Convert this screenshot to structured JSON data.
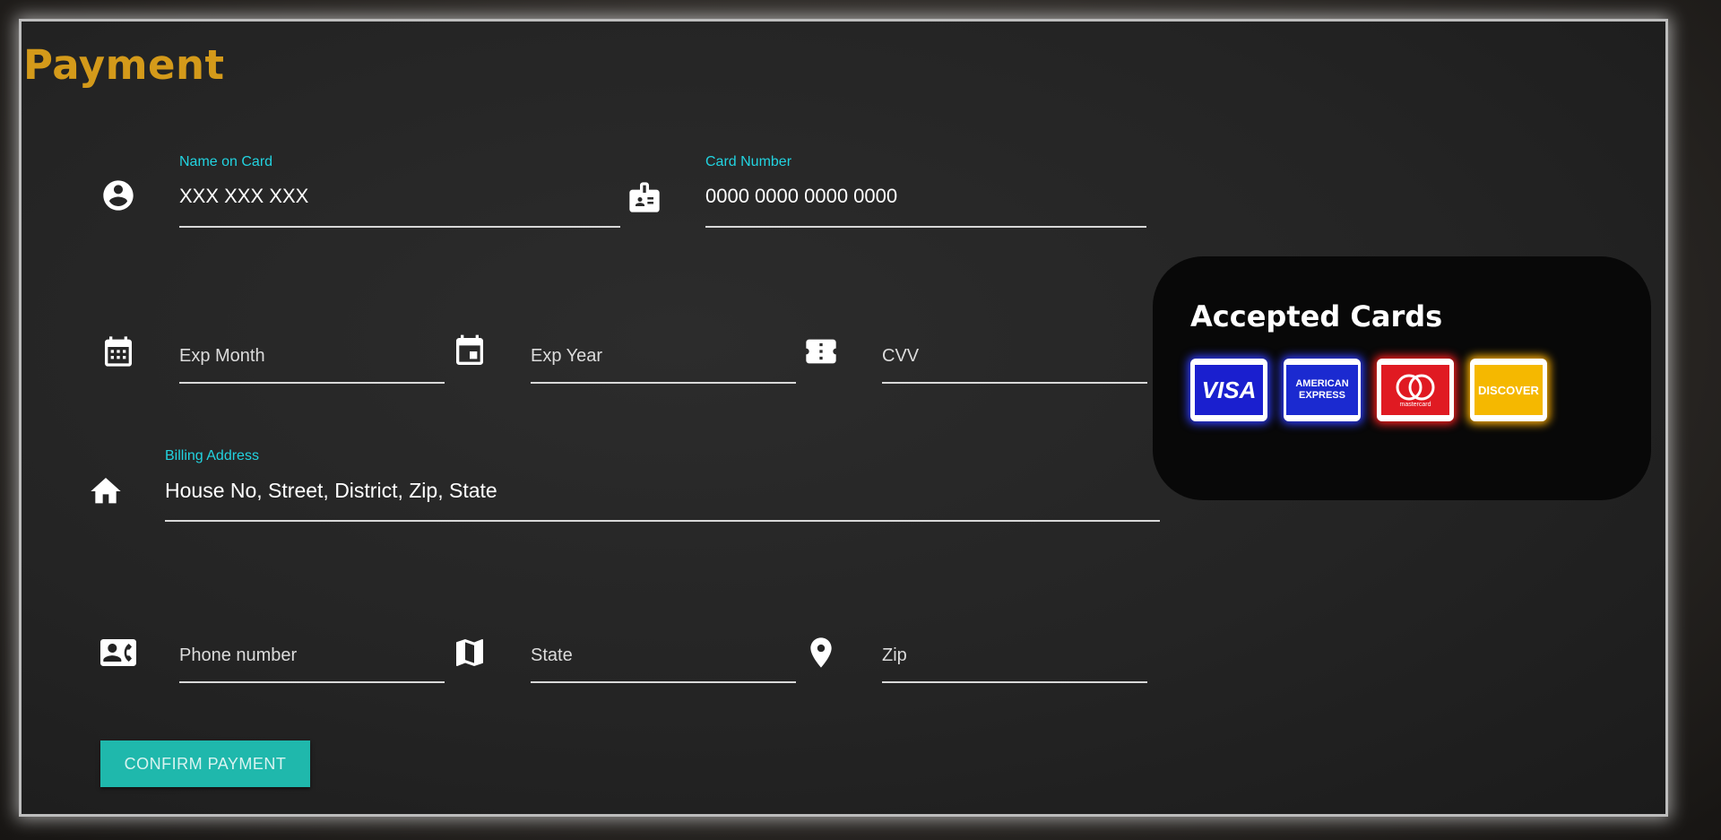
{
  "page": {
    "title": "Payment"
  },
  "fields": {
    "name_on_card": {
      "label": "Name on Card",
      "value": "XXX XXX XXX",
      "icon": "account-circle-icon"
    },
    "card_number": {
      "label": "Card Number",
      "value": "0000 0000 0000 0000",
      "icon": "badge-icon"
    },
    "exp_month": {
      "placeholder": "Exp Month",
      "icon": "calendar-icon"
    },
    "exp_year": {
      "placeholder": "Exp Year",
      "icon": "event-icon"
    },
    "cvv": {
      "placeholder": "CVV",
      "icon": "ticket-icon"
    },
    "billing_address": {
      "label": "Billing Address",
      "value": "House No, Street, District, Zip, State",
      "icon": "home-icon"
    },
    "phone": {
      "placeholder": "Phone number",
      "icon": "contact-phone-icon"
    },
    "state": {
      "placeholder": "State",
      "icon": "map-icon"
    },
    "zip": {
      "placeholder": "Zip",
      "icon": "location-pin-icon"
    }
  },
  "actions": {
    "confirm_label": "CONFIRM PAYMENT"
  },
  "accepted_cards": {
    "title": "Accepted Cards",
    "cards": [
      {
        "name": "VISA",
        "color": "#1a1fcf",
        "glow": "#2f3cff"
      },
      {
        "name": "AMERICAN EXPRESS",
        "color": "#1b2ad0",
        "glow": "#2f3cff"
      },
      {
        "name": "mastercard",
        "color": "#e01a22",
        "glow": "#ff2020"
      },
      {
        "name": "DISCOVER",
        "color": "#f5b800",
        "glow": "#ffb000"
      }
    ]
  },
  "colors": {
    "title": "#d49a1a",
    "label": "#22d3e0",
    "button": "#1fb8ac"
  }
}
